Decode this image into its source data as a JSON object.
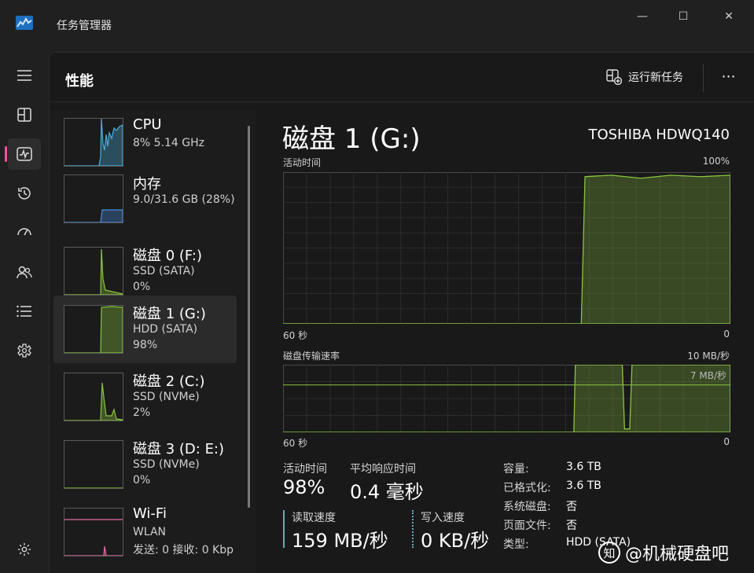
{
  "app": {
    "title": "任务管理器"
  },
  "window_controls": {
    "minimize": "—",
    "maximize": "☐",
    "close": "✕"
  },
  "header": {
    "page_title": "性能",
    "run_task_label": "运行新任务",
    "more": "⋯"
  },
  "nav": [
    {
      "name": "hamburger-menu-icon",
      "glyph": "☰"
    },
    {
      "name": "processes-icon",
      "glyph": "⊞"
    },
    {
      "name": "performance-icon",
      "glyph": "〰"
    },
    {
      "name": "app-history-icon",
      "glyph": "↺"
    },
    {
      "name": "startup-apps-icon",
      "glyph": "➚"
    },
    {
      "name": "users-icon",
      "glyph": "👥"
    },
    {
      "name": "details-icon",
      "glyph": "☰"
    },
    {
      "name": "services-icon",
      "glyph": "⚙"
    }
  ],
  "settings_icon": "⚙",
  "devices": [
    {
      "name": "CPU",
      "line1": "8%  5.14 GHz",
      "line2": "",
      "color": "#4ab0e0",
      "type": "cpu"
    },
    {
      "name": "内存",
      "line1": "9.0/31.6 GB (28%)",
      "line2": "",
      "color": "#4a8ce0",
      "type": "mem"
    },
    {
      "name": "磁盘 0 (F:)",
      "line1": "SSD (SATA)",
      "line2": "0%",
      "color": "#8bc43f",
      "type": "spike-left"
    },
    {
      "name": "磁盘 1 (G:)",
      "line1": "HDD (SATA)",
      "line2": "98%",
      "color": "#8bc43f",
      "type": "full"
    },
    {
      "name": "磁盘 2 (C:)",
      "line1": "SSD (NVMe)",
      "line2": "2%",
      "color": "#8bc43f",
      "type": "spike-mid"
    },
    {
      "name": "磁盘 3 (D: E:)",
      "line1": "SSD (NVMe)",
      "line2": "0%",
      "color": "#8bc43f",
      "type": "flat"
    },
    {
      "name": "Wi-Fi",
      "line1": "WLAN",
      "line2": "发送: 0 接收: 0 Kbp",
      "color": "#e06aa0",
      "type": "wifi"
    }
  ],
  "detail": {
    "title": "磁盘 1 (G:)",
    "model": "TOSHIBA HDWQ140",
    "active_time_graph": {
      "label": "活动时间",
      "max_label": "100%",
      "x_left": "60 秒",
      "x_right": "0"
    },
    "transfer_graph": {
      "label": "磁盘传输速率",
      "max_label": "10 MB/秒",
      "ref_label": "7 MB/秒",
      "x_left": "60 秒",
      "x_right": "0"
    },
    "stats": {
      "active_time_label": "活动时间",
      "active_time_value": "98%",
      "avg_response_label": "平均响应时间",
      "avg_response_value": "0.4 毫秒",
      "read_label": "读取速度",
      "read_value": "159 MB/秒",
      "write_label": "写入速度",
      "write_value": "0 KB/秒"
    },
    "props": [
      {
        "key": "容量:",
        "val": "3.6 TB"
      },
      {
        "key": "已格式化:",
        "val": "3.6 TB"
      },
      {
        "key": "系统磁盘:",
        "val": "否"
      },
      {
        "key": "页面文件:",
        "val": "否"
      },
      {
        "key": "类型:",
        "val": "HDD (SATA)"
      }
    ]
  },
  "chart_data": [
    {
      "type": "area",
      "title": "活动时间",
      "xlabel": "",
      "ylabel": "",
      "xlim": [
        60,
        0
      ],
      "ylim": [
        0,
        100
      ],
      "x": [
        60,
        20,
        19.5,
        16,
        12,
        8,
        4,
        0
      ],
      "values": [
        0,
        0,
        97,
        98,
        96,
        98,
        97,
        98
      ],
      "color": "#8bc43f"
    },
    {
      "type": "line",
      "title": "磁盘传输速率",
      "xlabel": "",
      "ylabel": "",
      "xlim": [
        60,
        0
      ],
      "ylim": [
        0,
        10
      ],
      "reference_line": 7,
      "x": [
        60,
        21,
        20.8,
        14.5,
        14.2,
        13.5,
        13.2,
        0
      ],
      "values": [
        0,
        0,
        10,
        10,
        0.5,
        0.5,
        10,
        10
      ],
      "color": "#8bc43f"
    }
  ],
  "watermark": {
    "logo": "知",
    "text": "@机械硬盘吧"
  }
}
